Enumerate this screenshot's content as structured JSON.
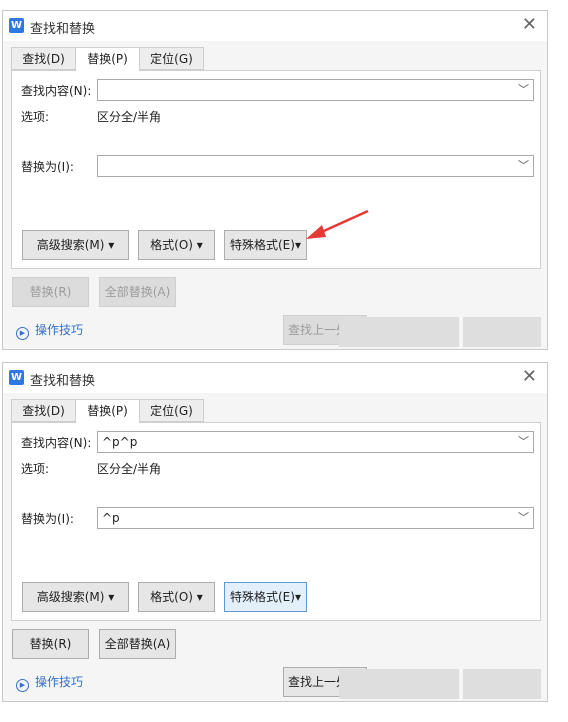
{
  "dialogs": [
    {
      "title": "查找和替换",
      "app_icon": "W",
      "tabs": [
        "查找(D)",
        "替换(P)",
        "定位(G)"
      ],
      "find_label": "查找内容(N):",
      "find_value": "",
      "options_label": "选项:",
      "options_value": "区分全/半角",
      "replace_label": "替换为(I):",
      "replace_value": "",
      "advanced_search": "高级搜索(M) ▾",
      "format": "格式(O) ▾",
      "special_format": "特殊格式(E)▾",
      "replace_btn": "替换(R)",
      "replace_all_btn": "全部替换(A)",
      "tips": "操作技巧",
      "find_prev": "查找上一处"
    },
    {
      "title": "查找和替换",
      "app_icon": "W",
      "tabs": [
        "查找(D)",
        "替换(P)",
        "定位(G)"
      ],
      "find_label": "查找内容(N):",
      "find_value": "^p^p",
      "options_label": "选项:",
      "options_value": "区分全/半角",
      "replace_label": "替换为(I):",
      "replace_value": "^p",
      "advanced_search": "高级搜索(M) ▾",
      "format": "格式(O) ▾",
      "special_format": "特殊格式(E)▾",
      "replace_btn": "替换(R)",
      "replace_all_btn": "全部替换(A)",
      "tips": "操作技巧",
      "find_prev": "查找上一处"
    }
  ],
  "annotation_color": "#e53935"
}
